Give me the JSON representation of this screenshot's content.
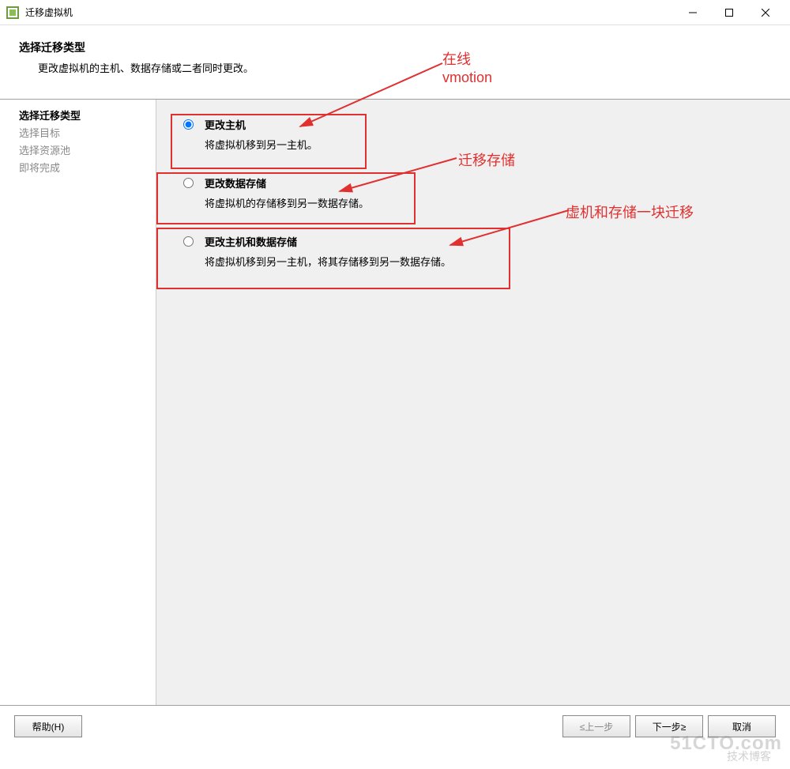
{
  "window": {
    "title": "迁移虚拟机"
  },
  "header": {
    "title": "选择迁移类型",
    "desc": "更改虚拟机的主机、数据存储或二者同时更改。"
  },
  "sidebar": {
    "items": [
      {
        "label": "选择迁移类型",
        "state": "active"
      },
      {
        "label": "选择目标",
        "state": "disabled"
      },
      {
        "label": "选择资源池",
        "state": "disabled"
      },
      {
        "label": "即将完成",
        "state": "disabled"
      }
    ]
  },
  "options": [
    {
      "title": "更改主机",
      "desc": "将虚拟机移到另一主机。",
      "selected": true
    },
    {
      "title": "更改数据存储",
      "desc": "将虚拟机的存储移到另一数据存储。",
      "selected": false
    },
    {
      "title": "更改主机和数据存储",
      "desc": "将虚拟机移到另一主机，将其存储移到另一数据存储。",
      "selected": false
    }
  ],
  "footer": {
    "help": "帮助(H)",
    "prev": "≤上一步",
    "next": "下一步≥",
    "cancel": "取消"
  },
  "annotations": {
    "ann1_line1": "在线",
    "ann1_line2": "vmotion",
    "ann2": "迁移存储",
    "ann3": "虚机和存储一块迁移"
  },
  "watermark": {
    "main": "51CTO.com",
    "sub": "技术博客"
  }
}
